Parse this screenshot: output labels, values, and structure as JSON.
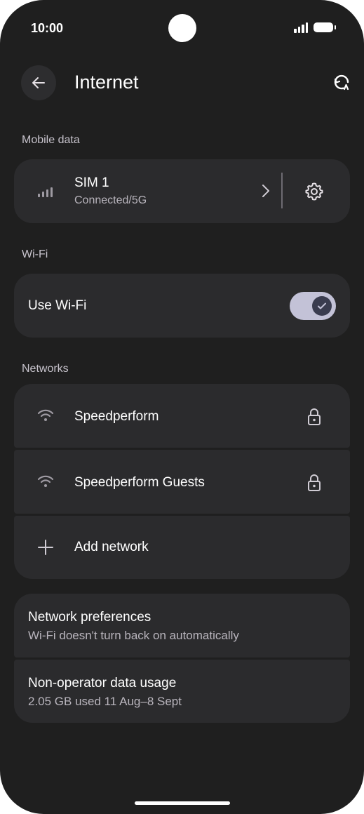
{
  "status": {
    "time": "10:00"
  },
  "header": {
    "title": "Internet"
  },
  "mobile_data": {
    "section_label": "Mobile data",
    "sim": {
      "name": "SIM 1",
      "status": "Connected/5G"
    }
  },
  "wifi": {
    "section_label": "Wi-Fi",
    "toggle_label": "Use Wi-Fi",
    "enabled": true
  },
  "networks": {
    "section_label": "Networks",
    "items": [
      {
        "name": "Speedperform",
        "icon": "wifi-icon",
        "locked": true
      },
      {
        "name": "Speedperform Guests",
        "icon": "wifi-icon",
        "locked": true
      }
    ],
    "add_label": "Add network"
  },
  "settings": {
    "items": [
      {
        "title": "Network preferences",
        "subtitle": "Wi-Fi doesn't turn back on automatically"
      },
      {
        "title": "Non-operator data usage",
        "subtitle": "2.05 GB used 11 Aug–8 Sept"
      }
    ]
  },
  "colors": {
    "background": "#1f1f1f",
    "card": "#2b2b2d",
    "toggle_track": "#c3c2d7",
    "toggle_knob": "#3a3c4f"
  }
}
